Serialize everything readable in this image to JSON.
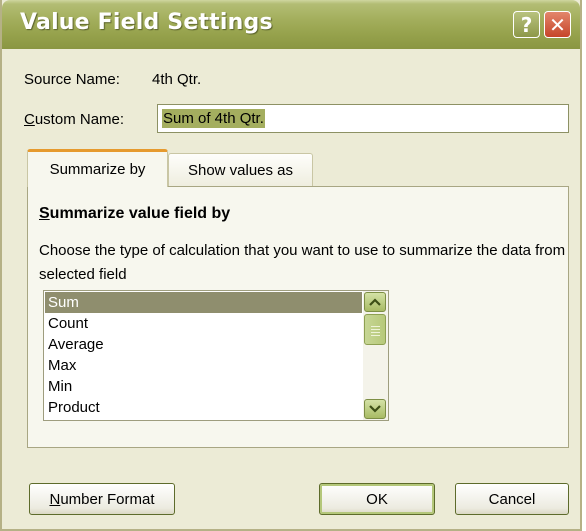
{
  "window": {
    "title": "Value Field Settings",
    "help_glyph": "?",
    "close_glyph": "✕"
  },
  "source": {
    "label": "Source Name:",
    "value": "4th Qtr."
  },
  "custom": {
    "label_accesskey": "C",
    "label_rest": "ustom Name:",
    "value": "Sum of 4th Qtr."
  },
  "tabs": [
    {
      "label": "Summarize by",
      "active": true
    },
    {
      "label": "Show values as",
      "active": false
    }
  ],
  "summarize": {
    "heading_accesskey": "S",
    "heading_rest": "ummarize value field by",
    "description": "Choose the type of calculation that you want to use to summarize the data from selected field",
    "items": [
      "Sum",
      "Count",
      "Average",
      "Max",
      "Min",
      "Product"
    ],
    "selected": "Sum"
  },
  "buttons": {
    "number_format_accesskey": "N",
    "number_format_rest": "umber Format",
    "ok": "OK",
    "cancel": "Cancel"
  },
  "colors": {
    "title_bar": "#9aa552",
    "selection": "#8f8e6e",
    "tab_accent": "#e69a2e",
    "dialog_bg": "#ecebd6"
  }
}
